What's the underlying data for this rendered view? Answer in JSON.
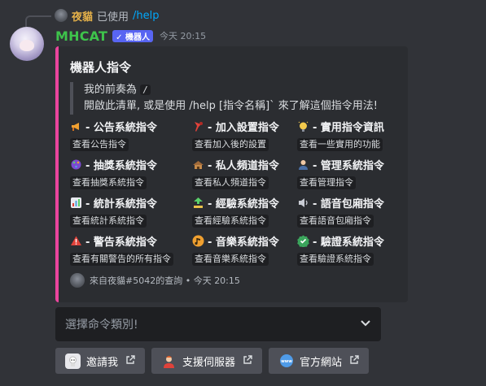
{
  "reply": {
    "username": "夜貓",
    "action": "已使用",
    "command": "/help"
  },
  "author": {
    "username": "MHCAT",
    "bot_tag": "✓ 機器人",
    "timestamp": "今天 20:15"
  },
  "embed": {
    "accent_color": "#eb459e",
    "title": "機器人指令",
    "description_line1_prefix": "我的前奏為",
    "prefix_code": "/",
    "description_line2": "開啟此清單, 或是使用 /help [指令名稱]` 來了解這個指令用法!",
    "fields": [
      {
        "icon": "megaphone-icon",
        "name": "- 公告系統指令",
        "value": "查看公告指令"
      },
      {
        "icon": "pushpin-icon",
        "name": "- 加入設置指令",
        "value": "查看加入後的設置"
      },
      {
        "icon": "sparkle-bulb-icon",
        "name": "- 實用指令資訊",
        "value": "查看一些實用的功能"
      },
      {
        "icon": "dice-icon",
        "name": "- 抽獎系統指令",
        "value": "查看抽獎系統指令"
      },
      {
        "icon": "hut-icon",
        "name": "- 私人頻道指令",
        "value": "查看私人頻道指令"
      },
      {
        "icon": "manager-icon",
        "name": "- 管理系統指令",
        "value": "查看管理指令"
      },
      {
        "icon": "bar-chart-icon",
        "name": "- 統計系統指令",
        "value": "查看統計系統指令"
      },
      {
        "icon": "level-up-icon",
        "name": "- 經驗系統指令",
        "value": "查看經驗系統指令"
      },
      {
        "icon": "speaker-icon",
        "name": "- 語音包廂指令",
        "value": "查看語音包廂指令"
      },
      {
        "icon": "warning-icon",
        "name": "- 警告系統指令",
        "value": "查看有關警告的所有指令"
      },
      {
        "icon": "music-note-icon",
        "name": "- 音樂系統指令",
        "value": "查看音樂系統指令"
      },
      {
        "icon": "verified-check-icon",
        "name": "- 驗證系統指令",
        "value": "查看驗證系統指令"
      }
    ],
    "footer": "來自夜貓#5042的查詢 • 今天 20:15"
  },
  "select_menu": {
    "placeholder": "選擇命令類別!"
  },
  "buttons": [
    {
      "icon": "invite-bot-icon",
      "label": "邀請我"
    },
    {
      "icon": "support-person-icon",
      "label": "支援伺服器"
    },
    {
      "icon": "website-icon",
      "label": "官方網站"
    }
  ]
}
